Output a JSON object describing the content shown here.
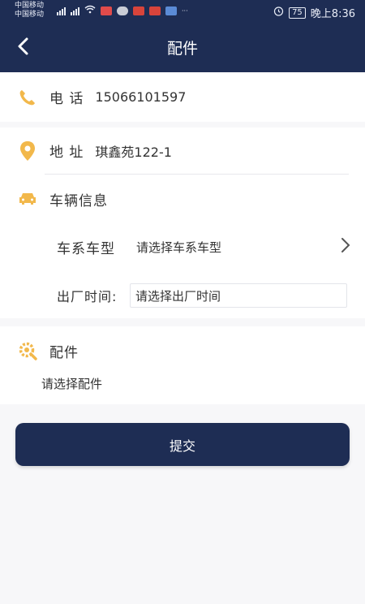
{
  "status_bar": {
    "carrier_1": "中国移动",
    "carrier_2": "中国移动",
    "battery": "75",
    "time": "晚上8:36"
  },
  "header": {
    "title": "配件"
  },
  "contact": {
    "phone_label": "电 话",
    "phone_value": "15066101597",
    "address_label": "地 址",
    "address_value": "琪鑫苑122-1"
  },
  "vehicle": {
    "section_label": "车辆信息",
    "model_label": "车系车型",
    "model_placeholder": "请选择车系车型",
    "date_label": "出厂时间:",
    "date_placeholder": "请选择出厂时间"
  },
  "parts": {
    "section_label": "配件",
    "placeholder": "请选择配件"
  },
  "submit_label": "提交",
  "colors": {
    "header_bg": "#1e2d54",
    "accent_icon": "#f2b84b",
    "page_bg": "#f7f7f9"
  }
}
